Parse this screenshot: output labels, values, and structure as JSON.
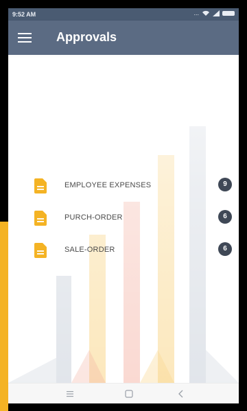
{
  "status_bar": {
    "time": "9:52 AM",
    "indicator_dots": "..."
  },
  "app_bar": {
    "title": "Approvals"
  },
  "approvals": [
    {
      "label": "EMPLOYEE EXPENSES",
      "count": "9",
      "icon": "document-icon"
    },
    {
      "label": "PURCH-ORDER",
      "count": "6",
      "icon": "document-icon"
    },
    {
      "label": "SALE-ORDER",
      "count": "6",
      "icon": "document-icon"
    }
  ],
  "colors": {
    "app_bar": "#5b6b83",
    "status_bar": "#4a5b72",
    "icon_accent": "#f4b324",
    "badge": "#3f4856",
    "side_strip": "#f4b324"
  },
  "nav_icons": [
    "recent-apps-icon",
    "home-icon",
    "back-icon"
  ]
}
